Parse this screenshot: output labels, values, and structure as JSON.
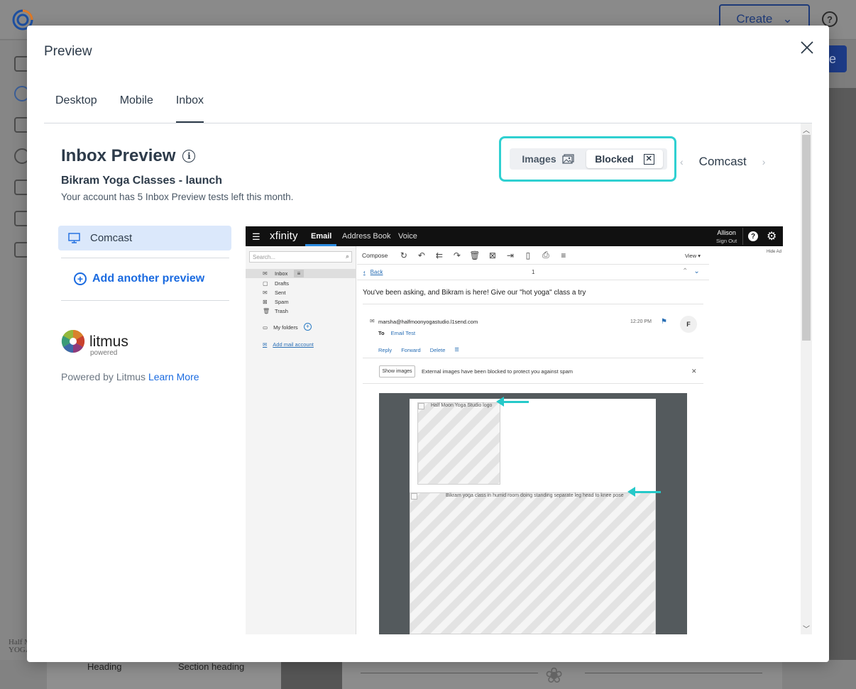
{
  "background": {
    "create_label": "Create",
    "help_icon": "question-circle-icon",
    "bottom_heading": "Heading",
    "bottom_section_heading": "Section heading"
  },
  "modal": {
    "title": "Preview",
    "close_icon": "close-icon",
    "tabs": [
      {
        "label": "Desktop"
      },
      {
        "label": "Mobile"
      },
      {
        "label": "Inbox"
      }
    ],
    "active_tab": "Inbox"
  },
  "inbox_preview": {
    "title": "Inbox Preview",
    "campaign_name": "Bikram Yoga Classes - launch",
    "tests_note": "Your account has 5 Inbox Preview tests left this month.",
    "images_label": "Images",
    "blocked_label": "Blocked",
    "selected_image_mode": "Blocked",
    "current_client": "Comcast",
    "highlight_color": "#2fd0d1"
  },
  "sidebar": {
    "clients": [
      {
        "label": "Comcast",
        "icon": "desktop-monitor-icon"
      }
    ],
    "add_preview_label": "Add another preview",
    "litmus_word": "litmus",
    "litmus_powered": "powered",
    "powered_by_text": "Powered by Litmus",
    "learn_more": "Learn More"
  },
  "xfinity": {
    "logo": "xfinity",
    "nav": [
      "Email",
      "Address Book",
      "Voice"
    ],
    "user_name": "Allison",
    "sign_out": "Sign Out",
    "search_placeholder": "Search...",
    "folders": [
      "Inbox",
      "Drafts",
      "Sent",
      "Spam",
      "Trash"
    ],
    "my_folders": "My folders",
    "add_mail_account": "Add mail account",
    "compose": "Compose",
    "view": "View ▾",
    "hide_ad": "Hide Ad",
    "back": "Back",
    "message_count": "1",
    "subject": "You've been asking, and Bikram is here! Give our \"hot yoga\" class a try",
    "sender": "marsha@halfmoonyogastudio.l1send.com",
    "to_label": "To",
    "to_value": "Email Test",
    "time": "12:20 PM",
    "avatar_letter": "F",
    "actions": [
      "Reply",
      "Forward",
      "Delete"
    ],
    "show_images": "Show images",
    "blocked_message": "External images have been blocked to protect you against spam",
    "alt_text_1": "Half Moon Yoga Studio logo",
    "alt_text_2": "Bikram yoga class in humid room doing standing separate leg head to knee pose"
  }
}
